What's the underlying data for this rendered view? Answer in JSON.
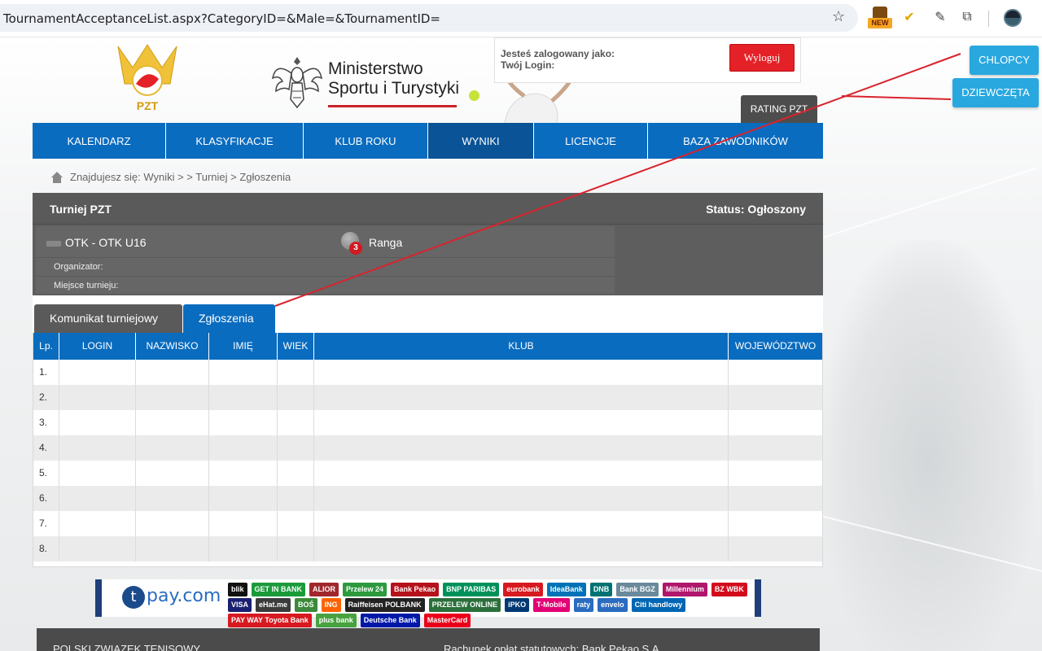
{
  "browser": {
    "url": "TournamentAcceptanceList.aspx?CategoryID=&Male=&TournamentID=",
    "new_badge": "NEW"
  },
  "header": {
    "logo_text": "PZT",
    "ministry_line1": "Ministerstwo",
    "ministry_line2": "Sportu i Turystyki",
    "logged_as_label": "Jesteś zalogowany jako:",
    "login_label": "Twój Login:",
    "logout_button": "Wyloguj",
    "rating_tab": "RATING PZT"
  },
  "nav": {
    "items": [
      {
        "label": "KALENDARZ"
      },
      {
        "label": "KLASYFIKACJE"
      },
      {
        "label": "KLUB ROKU"
      },
      {
        "label": "WYNIKI"
      },
      {
        "label": "LICENCJE"
      },
      {
        "label": "BAZA ZAWODNIKÓW"
      }
    ],
    "active": "WYNIKI"
  },
  "breadcrumb": "Znajdujesz się: Wyniki > > Turniej > Zgłoszenia",
  "tournament": {
    "header_left": "Turniej PZT",
    "header_right": "Status: Ogłoszony",
    "name": "OTK - OTK U16",
    "rank_number": "3",
    "rank_label": "Ranga",
    "organizer_label": "Organizator:",
    "place_label": "Miejsce turnieju:"
  },
  "tabs": {
    "tab1": "Komunikat turniejowy",
    "tab2": "Zgłoszenia",
    "tab2_chevron": "»"
  },
  "table": {
    "columns": [
      "Lp.",
      "LOGIN",
      "NAZWISKO",
      "IMIĘ",
      "WIEK",
      "KLUB",
      "WOJEWÓDZTWO"
    ],
    "rows": [
      "1.",
      "2.",
      "3.",
      "4.",
      "5.",
      "6.",
      "7.",
      "8."
    ]
  },
  "payment": {
    "brand": "pay.com",
    "brand_letter": "t",
    "banks": [
      {
        "name": "blik",
        "color": "#111111"
      },
      {
        "name": "GET IN BANK",
        "color": "#1a9b3a"
      },
      {
        "name": "ALIOR",
        "color": "#a0282d"
      },
      {
        "name": "Przelew 24",
        "color": "#2d9a3e"
      },
      {
        "name": "Bank Pekao",
        "color": "#b5121b"
      },
      {
        "name": "BNP PARIBAS",
        "color": "#00915a"
      },
      {
        "name": "eurobank",
        "color": "#d71920"
      },
      {
        "name": "IdeaBank",
        "color": "#0073b7"
      },
      {
        "name": "DNB",
        "color": "#007272"
      },
      {
        "name": "Bank BGZ",
        "color": "#6a8a9c"
      },
      {
        "name": "Millennium",
        "color": "#b0166b"
      },
      {
        "name": "BZ WBK",
        "color": "#d30c1c"
      },
      {
        "name": "VISA",
        "color": "#1a1f71"
      },
      {
        "name": "eHat.me",
        "color": "#3b3b3b"
      },
      {
        "name": "BOŚ",
        "color": "#3a8a3a"
      },
      {
        "name": "ING",
        "color": "#ff6200"
      },
      {
        "name": "Raiffeisen POLBANK",
        "color": "#222222"
      },
      {
        "name": "PRZELEW ONLINE",
        "color": "#2b6f3a"
      },
      {
        "name": "iPKO",
        "color": "#003874"
      },
      {
        "name": "T-Mobile",
        "color": "#e20074"
      },
      {
        "name": "raty",
        "color": "#2a6cbf"
      },
      {
        "name": "envelo",
        "color": "#2a6cbf"
      },
      {
        "name": "Citi handlowy",
        "color": "#0066b3"
      },
      {
        "name": "PAY WAY Toyota Bank",
        "color": "#d71920"
      },
      {
        "name": "plus bank",
        "color": "#47a23f"
      },
      {
        "name": "Deutsche Bank",
        "color": "#0018a8"
      },
      {
        "name": "MasterCard",
        "color": "#eb001b"
      }
    ]
  },
  "footer": {
    "left": "POLSKI ZWIĄZEK TENISOWY",
    "right": "Rachunek opłat statutowych: Bank Pekao S.A."
  },
  "gender": {
    "boys": "CHLOPCY",
    "girls": "DZIEWCZĘTA"
  },
  "colors": {
    "nav_blue": "#0a6cbf",
    "nav_active": "#0a5396",
    "panel_gray": "#5a5a5a",
    "logout_red": "#e42127",
    "gender_blue": "#29a8e0",
    "annotation_red": "#d9232e"
  }
}
